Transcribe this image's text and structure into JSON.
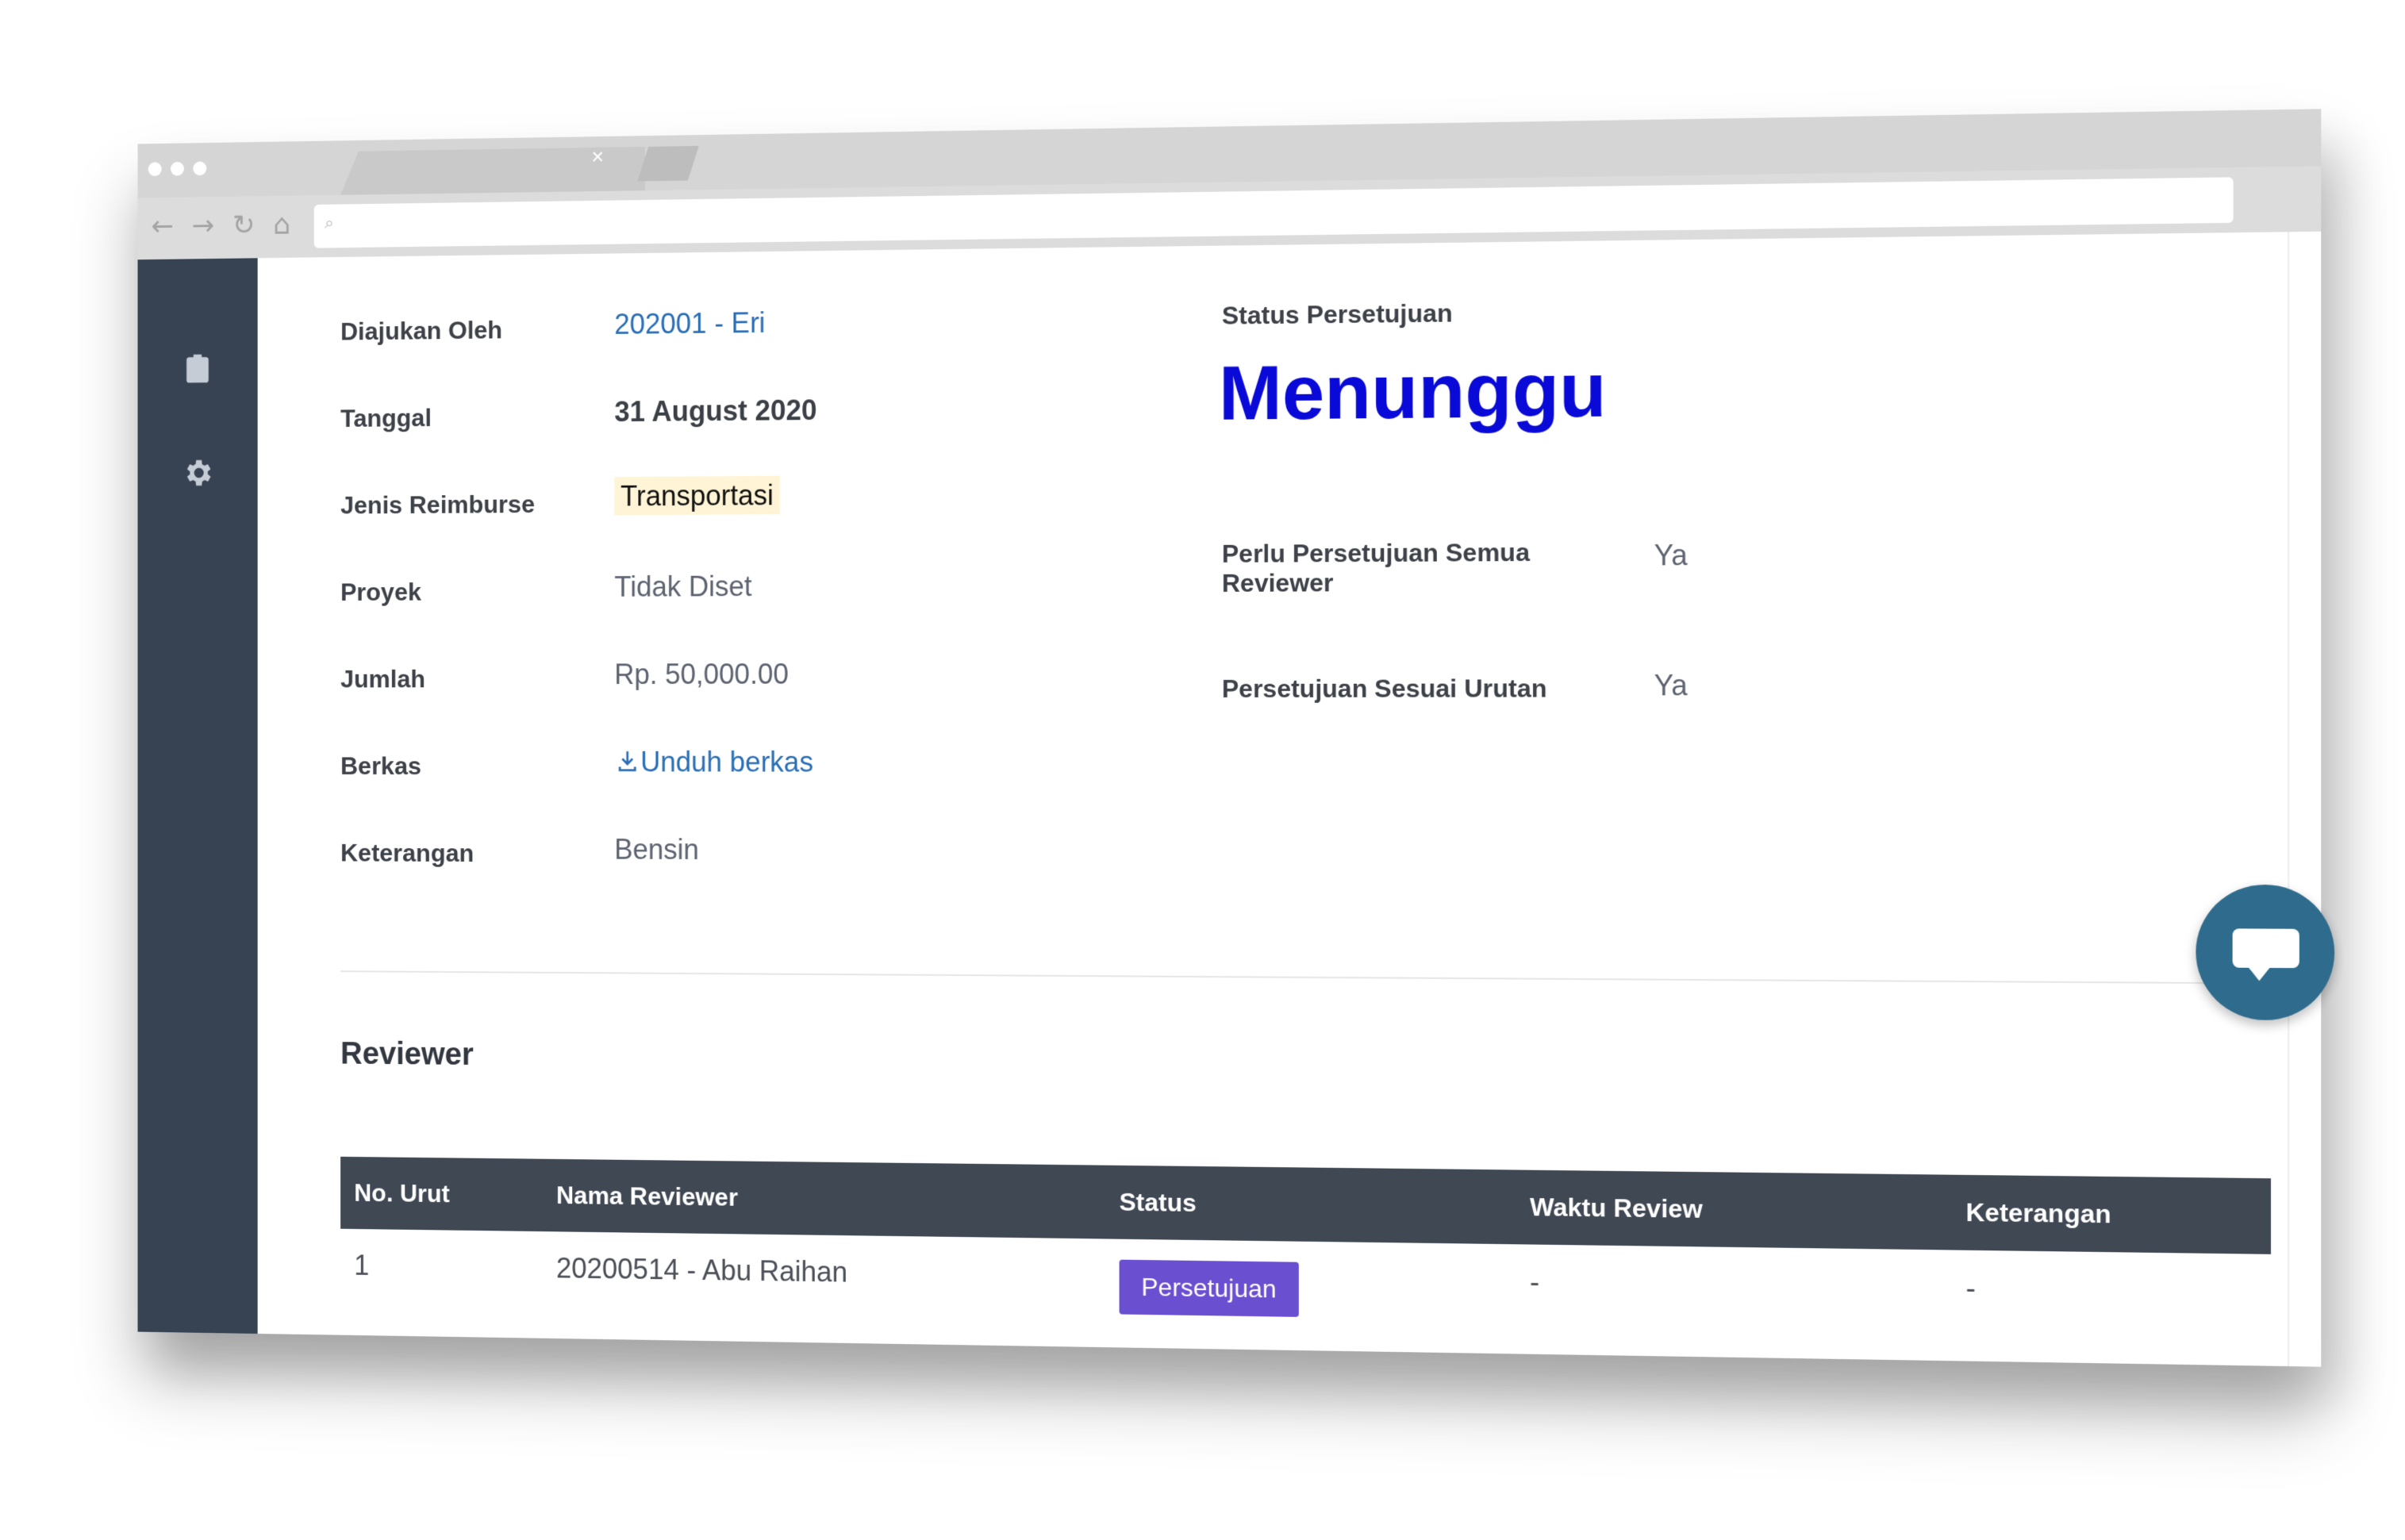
{
  "browser": {
    "tab_close": "×",
    "address_value": ""
  },
  "sidebar": {
    "items": [
      {
        "icon": "clipboard-check-icon"
      },
      {
        "icon": "gear-icon"
      }
    ]
  },
  "details": {
    "submitted_by_label": "Diajukan Oleh",
    "submitted_by_value": "202001 - Eri",
    "date_label": "Tanggal",
    "date_value": "31 August 2020",
    "type_label": "Jenis Reimburse",
    "type_value": "Transportasi",
    "project_label": "Proyek",
    "project_value": "Tidak Diset",
    "amount_label": "Jumlah",
    "amount_value": "Rp. 50,000.00",
    "file_label": "Berkas",
    "file_value": "Unduh berkas",
    "note_label": "Keterangan",
    "note_value": "Bensin"
  },
  "approval": {
    "status_label": "Status Persetujuan",
    "status_value": "Menunggu",
    "all_reviewer_label_line1": "Perlu Persetujuan Semua",
    "all_reviewer_label_line2": "Reviewer",
    "all_reviewer_value": "Ya",
    "ordered_label": "Persetujuan Sesuai Urutan",
    "ordered_value": "Ya"
  },
  "reviewer": {
    "title": "Reviewer",
    "columns": [
      "No. Urut",
      "Nama Reviewer",
      "Status",
      "Waktu Review",
      "Keterangan"
    ],
    "rows": [
      {
        "no": "1",
        "name": "20200514 - Abu Raihan",
        "status": "Persetujuan",
        "time": "-",
        "note": "-"
      }
    ]
  },
  "colors": {
    "sidebar": "#374352",
    "table_header": "#404854",
    "status_blue": "#0a0ad8",
    "link": "#2a6fb6",
    "status_button": "#6b4fd1",
    "chat_fab": "#2e6b8c"
  }
}
